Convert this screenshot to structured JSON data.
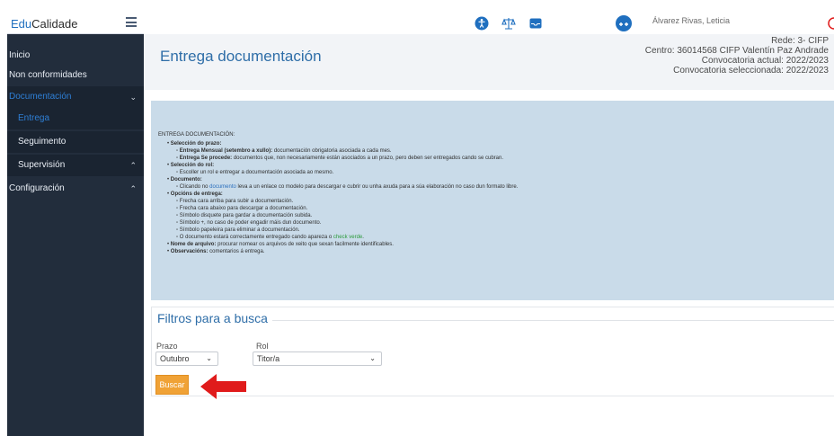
{
  "brand": {
    "prefix": "Edu",
    "suffix": "Calidade"
  },
  "sidebar": {
    "items": [
      {
        "label": "Inicio"
      },
      {
        "label": "Non conformidades"
      },
      {
        "label": "Documentación"
      },
      {
        "label": "Entrega"
      },
      {
        "label": "Seguimento"
      },
      {
        "label": "Supervisión"
      },
      {
        "label": "Configuración"
      }
    ]
  },
  "topbar": {
    "icons": [
      "accessibility-icon",
      "balance-scale-icon",
      "inbox-icon",
      "user-avatar-icon"
    ],
    "user_name": "Álvarez Rivas, Leticia"
  },
  "header": {
    "title": "Entrega documentación",
    "rede_label": "Rede",
    "rede_value": ": 3- CIFP",
    "centro_label": "Centro",
    "centro_value": ": 36014568 CIFP Valentín Paz Andrade",
    "conv_actual": "Convocatoria actual: 2022/2023",
    "conv_sel": "Convocatoria seleccionada: 2022/2023"
  },
  "info": {
    "title": "ENTREGA DOCUMENTACIÓN:",
    "s1": "Selección do prazo:",
    "s1a_b": "Entrega Mensual (setembro a xullo):",
    "s1a": " documentación obrigatoria asociada a cada mes.",
    "s1b_b": "Entrega Se procede:",
    "s1b": " documentos que, non necesariamente están asociados a un prazo, pero deben ser entregados cando se cubran.",
    "s2": "Selección do rol:",
    "s2a": "Escoller un rol e entregar a documentación asociada ao mesmo.",
    "s3": "Documento:",
    "s3a_1": "Clicando no ",
    "s3a_link": "documento",
    "s3a_2": " leva a un enlace co modelo para descargar e cubrir ou unha axuda para a súa elaboración no caso dun formato libre.",
    "s4": "Opcións de entrega:",
    "s4a": "Frecha cara arriba para subir a documentación.",
    "s4b": "Frecha cara abaixo para descargar a documentación.",
    "s4c": "Símbolo disquete para gardar a documentación subida.",
    "s4d": "Símbolo +, no caso de poder engadir máis dun documento.",
    "s4e": "Símbolo papeleira para eliminar a documentación.",
    "s4f_1": "O documento estará correctamente entregado cando apareza o ",
    "s4f_link": "check verde",
    "s4f_2": ".",
    "s5_b": "Nome de arquivo:",
    "s5": " procurar nomear os arquivos de xeito que sexan facilmente identificables.",
    "s6_b": "Observacións:",
    "s6": " comentarios á entrega."
  },
  "filters": {
    "title": "Filtros para a busca",
    "prazo_label": "Prazo",
    "prazo_value": "Outubro",
    "rol_label": "Rol",
    "rol_value": "Titor/a",
    "search_button": "Buscar"
  },
  "colors": {
    "sidebar_bg": "#222d3c",
    "accent_blue": "#2f6ea8",
    "info_bg": "#c9dbe9",
    "button_orange": "#f0a236",
    "arrow_red": "#e01b1b"
  }
}
